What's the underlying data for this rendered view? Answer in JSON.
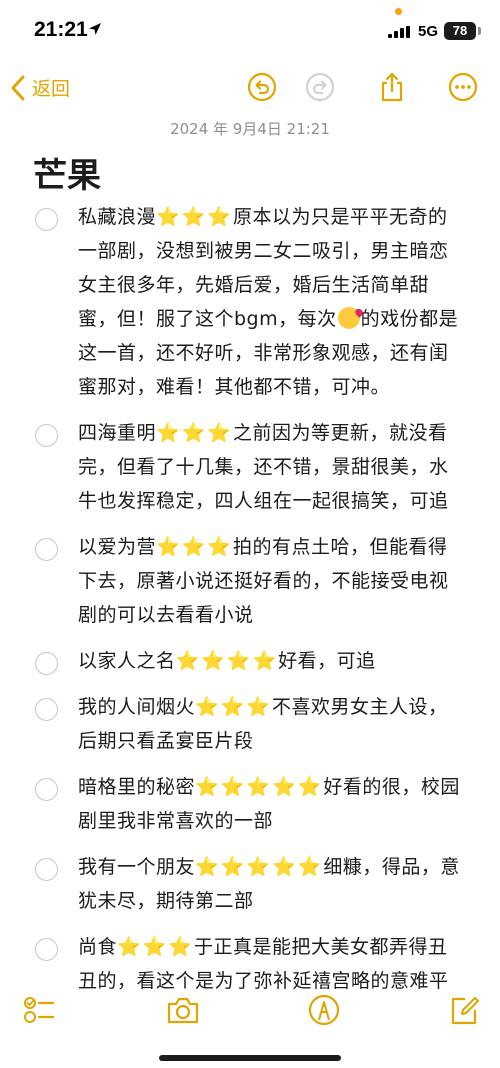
{
  "status_bar": {
    "time": "21:21",
    "network": "5G",
    "battery": "78"
  },
  "nav": {
    "back_label": "返回",
    "accent_color": "#e0a500"
  },
  "note": {
    "date": "2024 年 9月4日 21:21",
    "title": "芒果",
    "items": [
      {
        "name": "私藏浪漫",
        "stars": "⭐⭐⭐",
        "before_emoji": "原本以为只是平平无奇的一部剧，没想到被男二女二吸引，男主暗恋女主很多年，先婚后爱，婚后生活简单甜蜜，但！服了这个bgm，每次",
        "emoji": "kissing-face-emoji",
        "after_emoji": "的戏份都是这一首，还不好听，非常形象观感，还有闺蜜那对，难看！其他都不错，可冲。"
      },
      {
        "name": "四海重明",
        "stars": "⭐⭐⭐",
        "text": "之前因为等更新，就没看完，但看了十几集，还不错，景甜很美，水牛也发挥稳定，四人组在一起很搞笑，可追"
      },
      {
        "name": "以爱为营",
        "stars": "⭐⭐⭐",
        "text": "拍的有点土哈，但能看得下去，原著小说还挺好看的，不能接受电视剧的可以去看看小说"
      },
      {
        "name": "以家人之名",
        "stars": "⭐⭐⭐⭐",
        "text": "好看，可追"
      },
      {
        "name": "我的人间烟火",
        "stars": "⭐⭐⭐",
        "text": "不喜欢男女主人设，后期只看孟宴臣片段"
      },
      {
        "name": "暗格里的秘密",
        "stars": "⭐⭐⭐⭐⭐",
        "text": "好看的很，校园剧里我非常喜欢的一部"
      },
      {
        "name": "我有一个朋友",
        "stars": "⭐⭐⭐⭐⭐",
        "text": "细糠，得品，意犹未尽，期待第二部"
      },
      {
        "name": "尚食",
        "stars": "⭐⭐⭐",
        "text": "于正真是能把大美女都弄得丑丑的，看这个是为了弥补延禧宫略的意难平"
      }
    ]
  },
  "toolbar": {
    "icons": [
      "checklist-icon",
      "camera-icon",
      "markup-icon",
      "compose-icon"
    ]
  }
}
